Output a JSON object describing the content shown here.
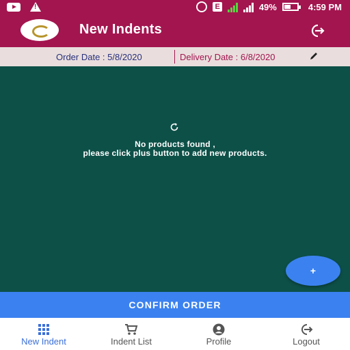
{
  "status_bar": {
    "icons": [
      "youtube-icon",
      "warning-icon",
      "alarm-icon",
      "e-network-icon",
      "signal-icon",
      "signal-2-icon",
      "battery-icon"
    ],
    "network_badge": "E",
    "battery": "49%",
    "time": "4:59 PM"
  },
  "app_bar": {
    "title": "New Indents",
    "logout_icon": "exit-icon"
  },
  "dates": {
    "order_date": "Order Date : 5/8/2020",
    "delivery_date": "Delivery Date : 6/8/2020",
    "edit_icon": "pencil-icon"
  },
  "main": {
    "empty_line1": "No products found ,",
    "empty_line2": "please click plus button to add new products.",
    "fab_label": "+"
  },
  "confirm": {
    "label": "CONFIRM ORDER"
  },
  "bottom_nav": {
    "items": [
      {
        "label": "New Indent",
        "icon": "grid-icon",
        "active": true
      },
      {
        "label": "Indent List",
        "icon": "cart-icon",
        "active": false
      },
      {
        "label": "Profile",
        "icon": "profile-icon",
        "active": false
      },
      {
        "label": "Logout",
        "icon": "logout-icon",
        "active": false
      }
    ]
  },
  "colors": {
    "primary": "#a3154f",
    "background": "#0d5048",
    "accent": "#3b82f0",
    "date_bar": "#e9dedd",
    "active_nav": "#3b6fd8"
  }
}
